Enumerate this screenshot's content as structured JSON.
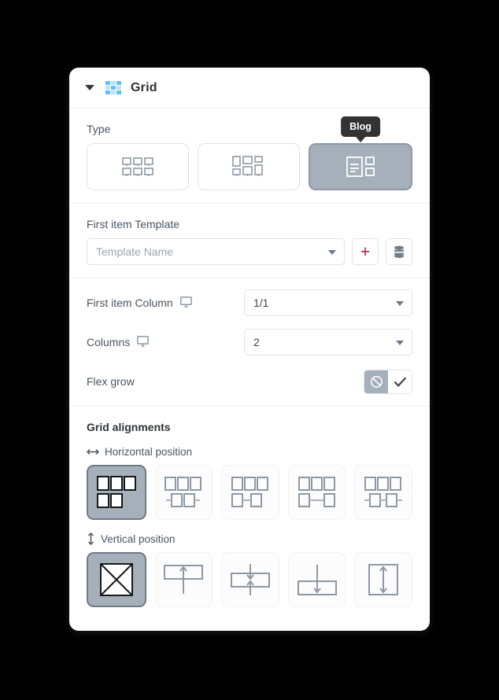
{
  "panel": {
    "title": "Grid",
    "collapse_icon": "chevron-down-icon",
    "grid_icon": "grid-icon"
  },
  "type_section": {
    "label": "Type",
    "tooltip": "Blog",
    "options": [
      {
        "name": "uniform-grid",
        "icon": "uniform-grid-icon",
        "selected": false
      },
      {
        "name": "masonry-grid",
        "icon": "masonry-grid-icon",
        "selected": false
      },
      {
        "name": "blog-grid",
        "icon": "blog-layout-icon",
        "selected": true
      }
    ]
  },
  "template_section": {
    "label": "First item Template",
    "select_placeholder": "Template Name",
    "select_value": "",
    "caret_icon": "chevron-down-icon",
    "add_button_label": "+",
    "add_button_color": "#ad1a45",
    "library_button_icon": "database-stack-icon"
  },
  "layout_section": {
    "first_item_column": {
      "label": "First item Column",
      "device_icon": "desktop-monitor-icon",
      "value": "1/1"
    },
    "columns": {
      "label": "Columns",
      "device_icon": "desktop-monitor-icon",
      "value": "2"
    },
    "flex_grow": {
      "label": "Flex grow",
      "off_icon": "ban-circle-icon",
      "on_icon": "check-icon",
      "selected": "off"
    }
  },
  "alignments": {
    "title": "Grid alignments",
    "horizontal": {
      "label": "Horizontal position",
      "icon": "arrows-horizontal-icon",
      "options": [
        {
          "name": "h-align-none",
          "selected": true
        },
        {
          "name": "h-align-start",
          "selected": false
        },
        {
          "name": "h-align-end",
          "selected": false
        },
        {
          "name": "h-align-space-between",
          "selected": false
        },
        {
          "name": "h-align-space-around",
          "selected": false
        }
      ]
    },
    "vertical": {
      "label": "Vertical position",
      "icon": "arrows-vertical-icon",
      "options": [
        {
          "name": "v-align-none",
          "selected": true
        },
        {
          "name": "v-align-top",
          "selected": false
        },
        {
          "name": "v-align-center",
          "selected": false
        },
        {
          "name": "v-align-bottom",
          "selected": false
        },
        {
          "name": "v-align-stretch",
          "selected": false
        }
      ]
    }
  },
  "colors": {
    "selected_bg": "#a6b0ba",
    "accent": "#ad1a45",
    "brand_icon": "#5ec2f0",
    "tooltip_bg": "#333333"
  }
}
